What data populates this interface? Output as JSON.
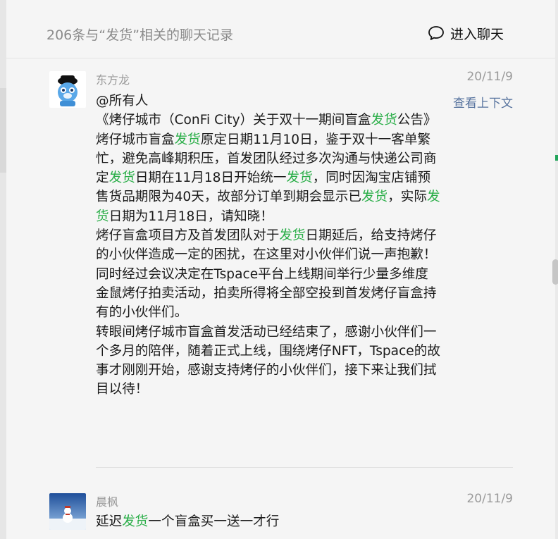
{
  "header": {
    "title": "206条与“发货”相关的聊天记录",
    "enter_chat_label": "进入聊天"
  },
  "messages": [
    {
      "sender": "东方龙",
      "date": "20/11/9",
      "context_link": "查看上下文",
      "segments": [
        "@所有人\n《烤仔城市（ConFi City）关于双十一期间盲盒",
        {
          "hl": "发货"
        },
        "公告》\n烤仔城市盲盒",
        {
          "hl": "发货"
        },
        "原定日期11月10日，鉴于双十一客单繁忙，避免高峰期积压，首发团队经过多次沟通与快递公司商定",
        {
          "hl": "发货"
        },
        "日期在11月18日开始统一",
        {
          "hl": "发货"
        },
        "，同时因淘宝店铺预售货品期限为40天，故部分订单到期会显示已",
        {
          "hl": "发货"
        },
        "，实际",
        {
          "hl": "发货"
        },
        "日期为11月18日，请知晓！\n烤仔盲盒项目方及首发团队对于",
        {
          "hl": "发货"
        },
        "日期延后，给支持烤仔的小伙伴造成一定的困扰，在这里对小伙伴们说一声抱歉！同时经过会议决定在Tspace平台上线期间举行少量多维度金鼠烤仔拍卖活动，拍卖所得将全部空投到首发烤仔盲盒持有的小伙伴们。\n转眼间烤仔城市盲盒首发活动已经结束了，感谢小伙伴们一个多月的陪伴，随着正式上线，围绕烤仔NFT，Tspace的故事才刚刚开始，感谢支持烤仔的小伙伴们，接下来让我们拭目以待！"
      ]
    },
    {
      "sender": "晨枫",
      "date": "20/11/9",
      "segments": [
        "延迟",
        {
          "hl": "发货"
        },
        "一个盲盒买一送一才行"
      ]
    }
  ],
  "colors": {
    "highlight": "#2aae48",
    "link": "#57739e",
    "muted": "#9a9a9a"
  }
}
